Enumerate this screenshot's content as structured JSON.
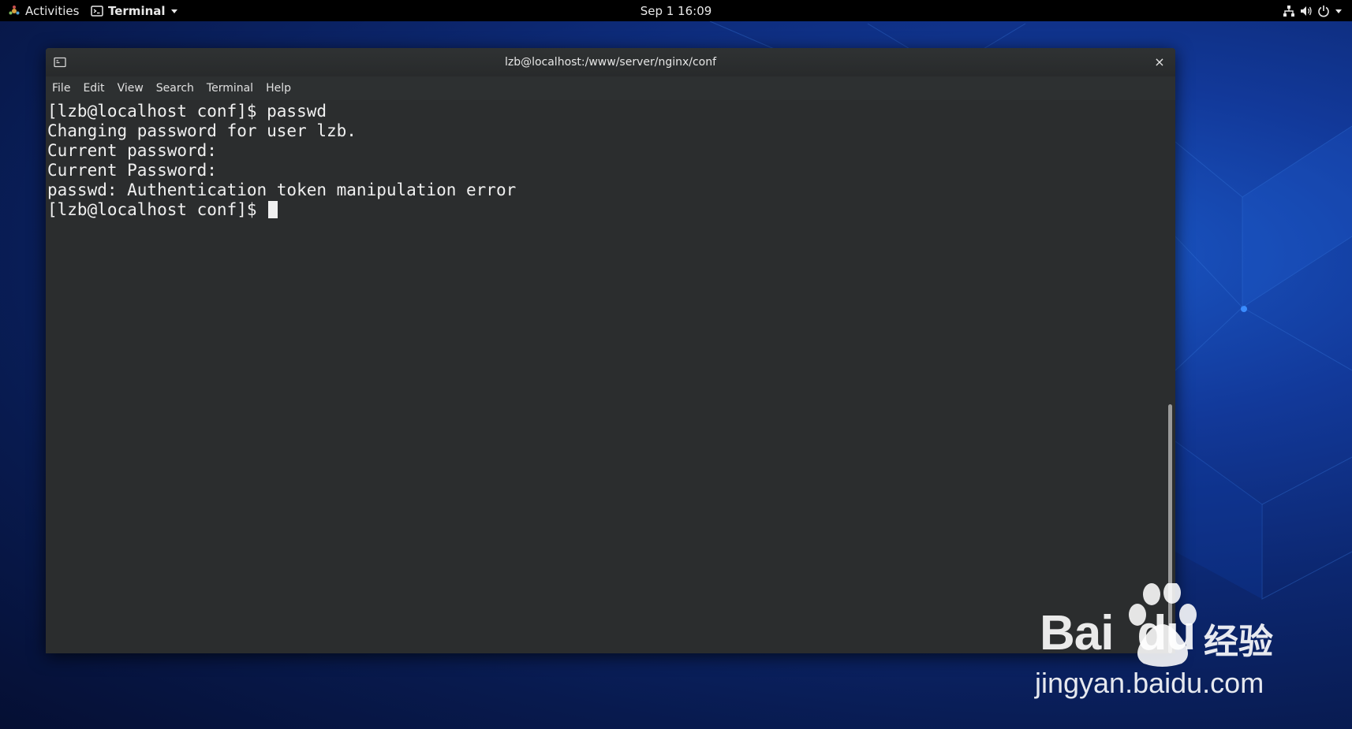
{
  "topbar": {
    "activities_label": "Activities",
    "app_menu_label": "Terminal",
    "clock": "Sep 1  16:09",
    "icons": [
      "network-icon",
      "volume-icon",
      "power-icon",
      "chevron-down-icon"
    ]
  },
  "window": {
    "title": "lzb@localhost:/www/server/nginx/conf",
    "close_glyph": "×",
    "menu": [
      "File",
      "Edit",
      "View",
      "Search",
      "Terminal",
      "Help"
    ]
  },
  "terminal": {
    "lines": [
      "[lzb@localhost conf]$ passwd",
      "Changing password for user lzb.",
      "Current password:",
      "Current Password:",
      "passwd: Authentication token manipulation error"
    ],
    "prompt": "[lzb@localhost conf]$ ",
    "scroll_position": 0.5
  },
  "watermark": {
    "brand_text": "Bai",
    "brand_text_end": "du",
    "brand_cn": "经验",
    "url": "jingyan.baidu.com"
  },
  "colors": {
    "terminal_bg": "#2b2d2e",
    "terminal_fg": "#f0f0f0",
    "topbar_bg": "#000000",
    "wallpaper_accent": "#1a56c4"
  }
}
